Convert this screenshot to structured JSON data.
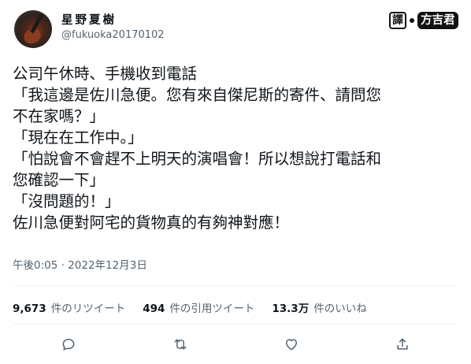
{
  "author": {
    "display_name": "星野夏樹",
    "handle": "@fukuoka20170102"
  },
  "watermark": {
    "seal": "譯",
    "translator": "方吉君"
  },
  "tweet": {
    "lines": [
      "公司午休時、手機收到電話",
      "「我這邊是佐川急便。您有來自傑尼斯的寄件、請問您",
      "不在家嗎？」",
      "「現在在工作中。」",
      "「怕說會不會趕不上明天的演唱會！所以想說打電話和",
      "您確認一下」",
      "「沒問題的！」",
      "佐川急便對阿宅的貨物真的有夠神對應！"
    ],
    "timestamp": "午後0:05 · 2022年12月3日"
  },
  "stats": {
    "retweets_count": "9,673",
    "retweets_label": "件のリツイート",
    "quotes_count": "494",
    "quotes_label": "件の引用ツイート",
    "likes_count": "13.3万",
    "likes_label": "件のいいね"
  },
  "actions": {
    "icons": [
      "reply-icon",
      "retweet-icon",
      "like-icon",
      "share-icon"
    ]
  }
}
